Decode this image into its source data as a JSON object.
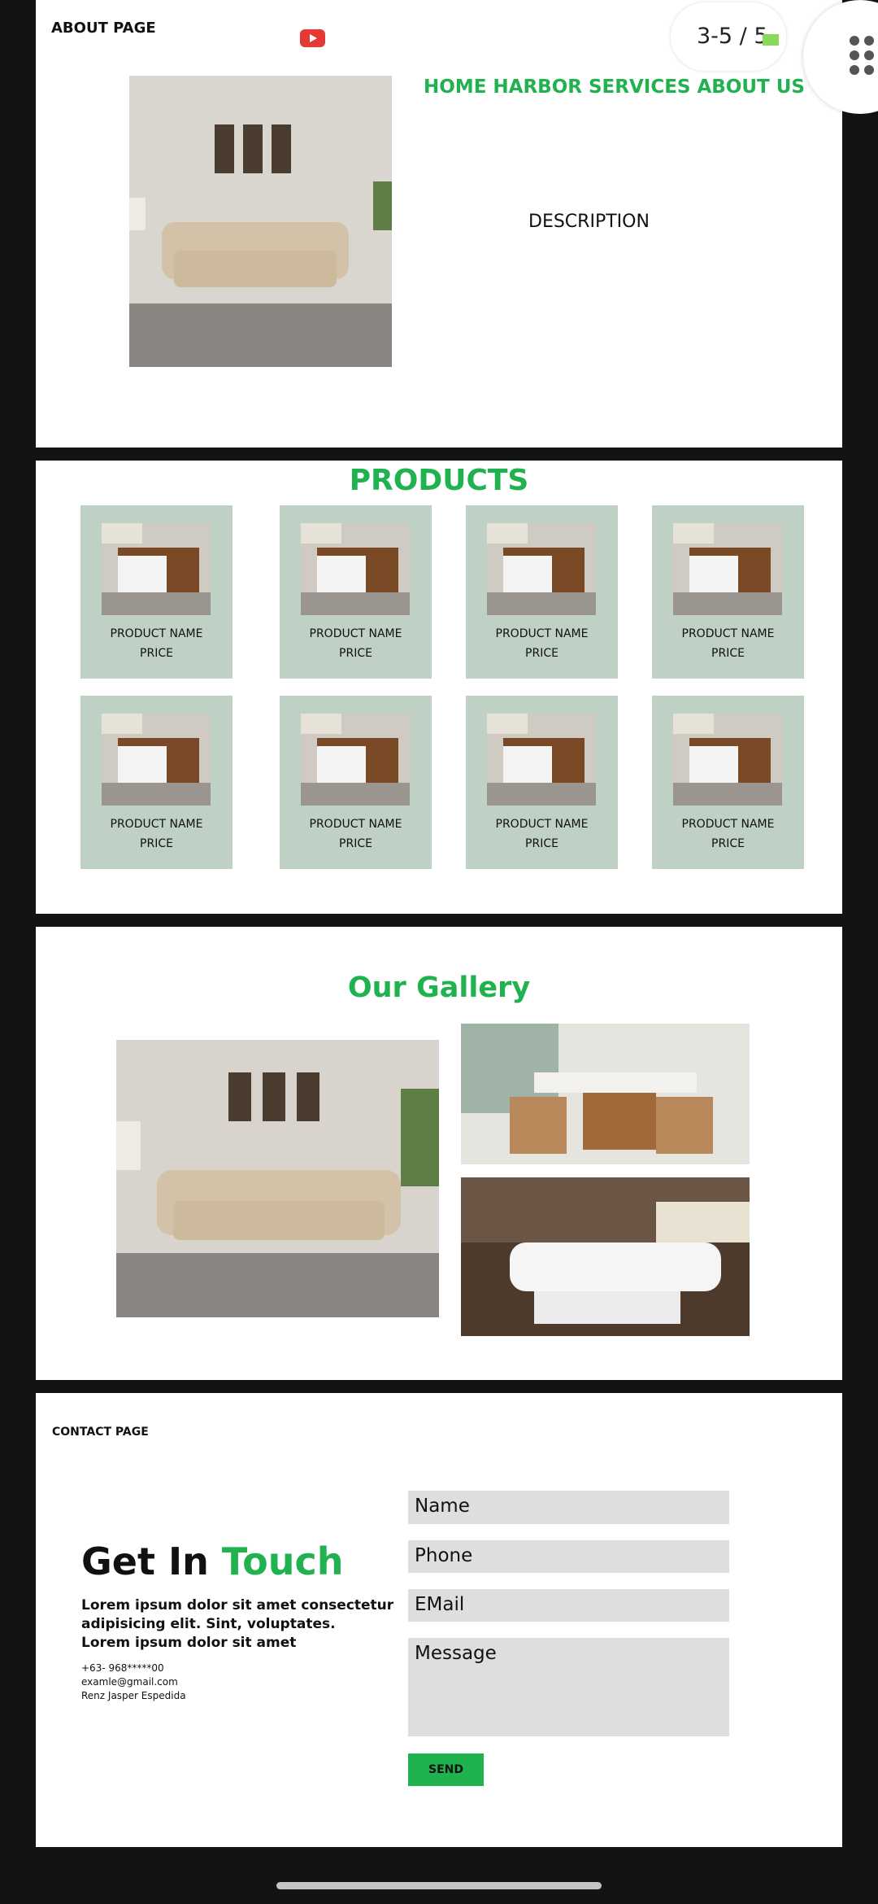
{
  "about": {
    "page_label": "ABOUT PAGE",
    "heading": "HOME HARBOR SERVICES ABOUT US",
    "description": "DESCRIPTION"
  },
  "overlay": {
    "page_counter": "3-5 / 5",
    "youtube_icon": "youtube-icon",
    "menu_icon": "apps-grid-icon"
  },
  "products": {
    "title": "PRODUCTS",
    "items": [
      {
        "name": "PRODUCT NAME",
        "price": "PRICE"
      },
      {
        "name": "PRODUCT NAME",
        "price": "PRICE"
      },
      {
        "name": "PRODUCT NAME",
        "price": "PRICE"
      },
      {
        "name": "PRODUCT NAME",
        "price": "PRICE"
      },
      {
        "name": "PRODUCT NAME",
        "price": "PRICE"
      },
      {
        "name": "PRODUCT NAME",
        "price": "PRICE"
      },
      {
        "name": "PRODUCT NAME",
        "price": "PRICE"
      },
      {
        "name": "PRODUCT NAME",
        "price": "PRICE"
      }
    ]
  },
  "gallery": {
    "title": "Our Gallery"
  },
  "contact": {
    "page_label": "CONTACT PAGE",
    "heading_part1": "Get In",
    "heading_part2": "Touch",
    "body_line1": "Lorem ipsum dolor sit amet consectetur",
    "body_line2": "adipisicing elit. Sint, voluptates.",
    "body_line3": "Lorem ipsum dolor sit amet",
    "phone": "+63- 968*****00",
    "email": "examle@gmail.com",
    "author": "Renz Jasper Espedida",
    "name_placeholder": "Name",
    "phone_placeholder": "Phone",
    "email_placeholder": "EMail",
    "message_placeholder": "Message",
    "send_label": "SEND"
  },
  "colors": {
    "accent_green": "#1fb24e",
    "card_bg": "#bfd0c4",
    "frame_bg": "#111410"
  }
}
